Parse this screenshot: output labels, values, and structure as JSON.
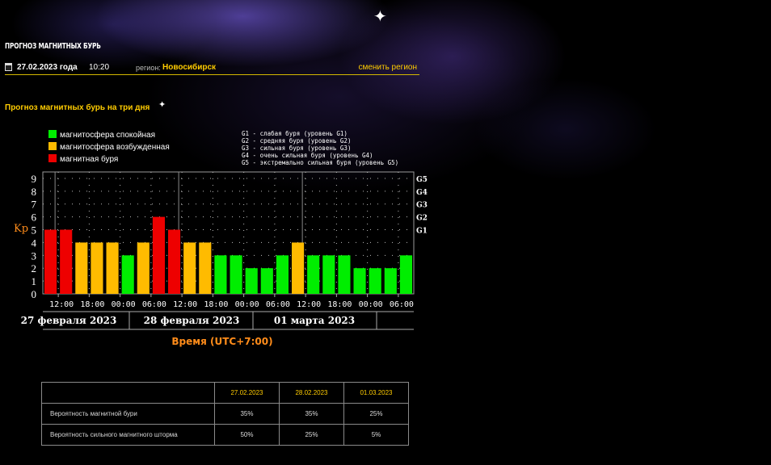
{
  "colors": {
    "calm": "#00ee00",
    "excited": "#ffbb00",
    "storm": "#ee0000",
    "accent": "#ffcc00",
    "axis_label": "#ff8c1a"
  },
  "header": {
    "site_title": "ПРОГНОЗ МАГНИТНЫХ БУРЬ",
    "date": "27.02.2023 года",
    "time": "10:20",
    "region_label": "регион:",
    "region_name": "Новосибирск",
    "change_region": "сменить регион"
  },
  "subtitle": "Прогноз магнитных бурь на три дня",
  "legend": {
    "levels": [
      {
        "label": "магнитосфера спокойная",
        "color": "#00ee00"
      },
      {
        "label": "магнитосфера возбужденная",
        "color": "#ffbb00"
      },
      {
        "label": "магнитная буря",
        "color": "#ee0000"
      }
    ],
    "g_scale": [
      "G1 - слабая буря (уровень G1)",
      "G2 - средняя буря (уровень G2)",
      "G3 - сильная буря (уровень G3)",
      "G4 - очень сильная буря (уровень G4)",
      "G5 - экстремально сильная буря (уровень G5)"
    ]
  },
  "chart_data": {
    "type": "bar",
    "ylabel": "Kp",
    "xlabel": "Время (UTC+7:00)",
    "ylim": [
      0,
      9
    ],
    "y_ticks": [
      "0",
      "1",
      "2",
      "3",
      "4",
      "5",
      "6",
      "7",
      "8",
      "9"
    ],
    "g_ticks": [
      {
        "label": "G1",
        "kp": 5
      },
      {
        "label": "G2",
        "kp": 6
      },
      {
        "label": "G3",
        "kp": 7
      },
      {
        "label": "G4",
        "kp": 8
      },
      {
        "label": "G5",
        "kp": 9
      }
    ],
    "x_ticks": [
      "12:00",
      "18:00",
      "00:00",
      "06:00",
      "12:00",
      "18:00",
      "00:00",
      "06:00",
      "12:00",
      "18:00",
      "00:00",
      "06:00"
    ],
    "days": [
      "27 февраля 2023",
      "28 февраля 2023",
      "01 марта 2023"
    ],
    "values": [
      5,
      5,
      4,
      4,
      4,
      3,
      4,
      6,
      5,
      4,
      4,
      3,
      3,
      2,
      2,
      3,
      4,
      3,
      3,
      3,
      2,
      2,
      2,
      3
    ],
    "levels": [
      "storm",
      "storm",
      "excited",
      "excited",
      "excited",
      "calm",
      "excited",
      "storm",
      "storm",
      "excited",
      "excited",
      "calm",
      "calm",
      "calm",
      "calm",
      "calm",
      "excited",
      "calm",
      "calm",
      "calm",
      "calm",
      "calm",
      "calm",
      "calm"
    ],
    "grid": true
  },
  "table": {
    "dates": [
      "27.02.2023",
      "28.02.2023",
      "01.03.2023"
    ],
    "rows": [
      {
        "label": "Вероятность магнитной бури",
        "values": [
          "35%",
          "35%",
          "25%"
        ]
      },
      {
        "label": "Вероятность сильного магнитного шторма",
        "values": [
          "50%",
          "25%",
          "5%"
        ]
      }
    ]
  }
}
